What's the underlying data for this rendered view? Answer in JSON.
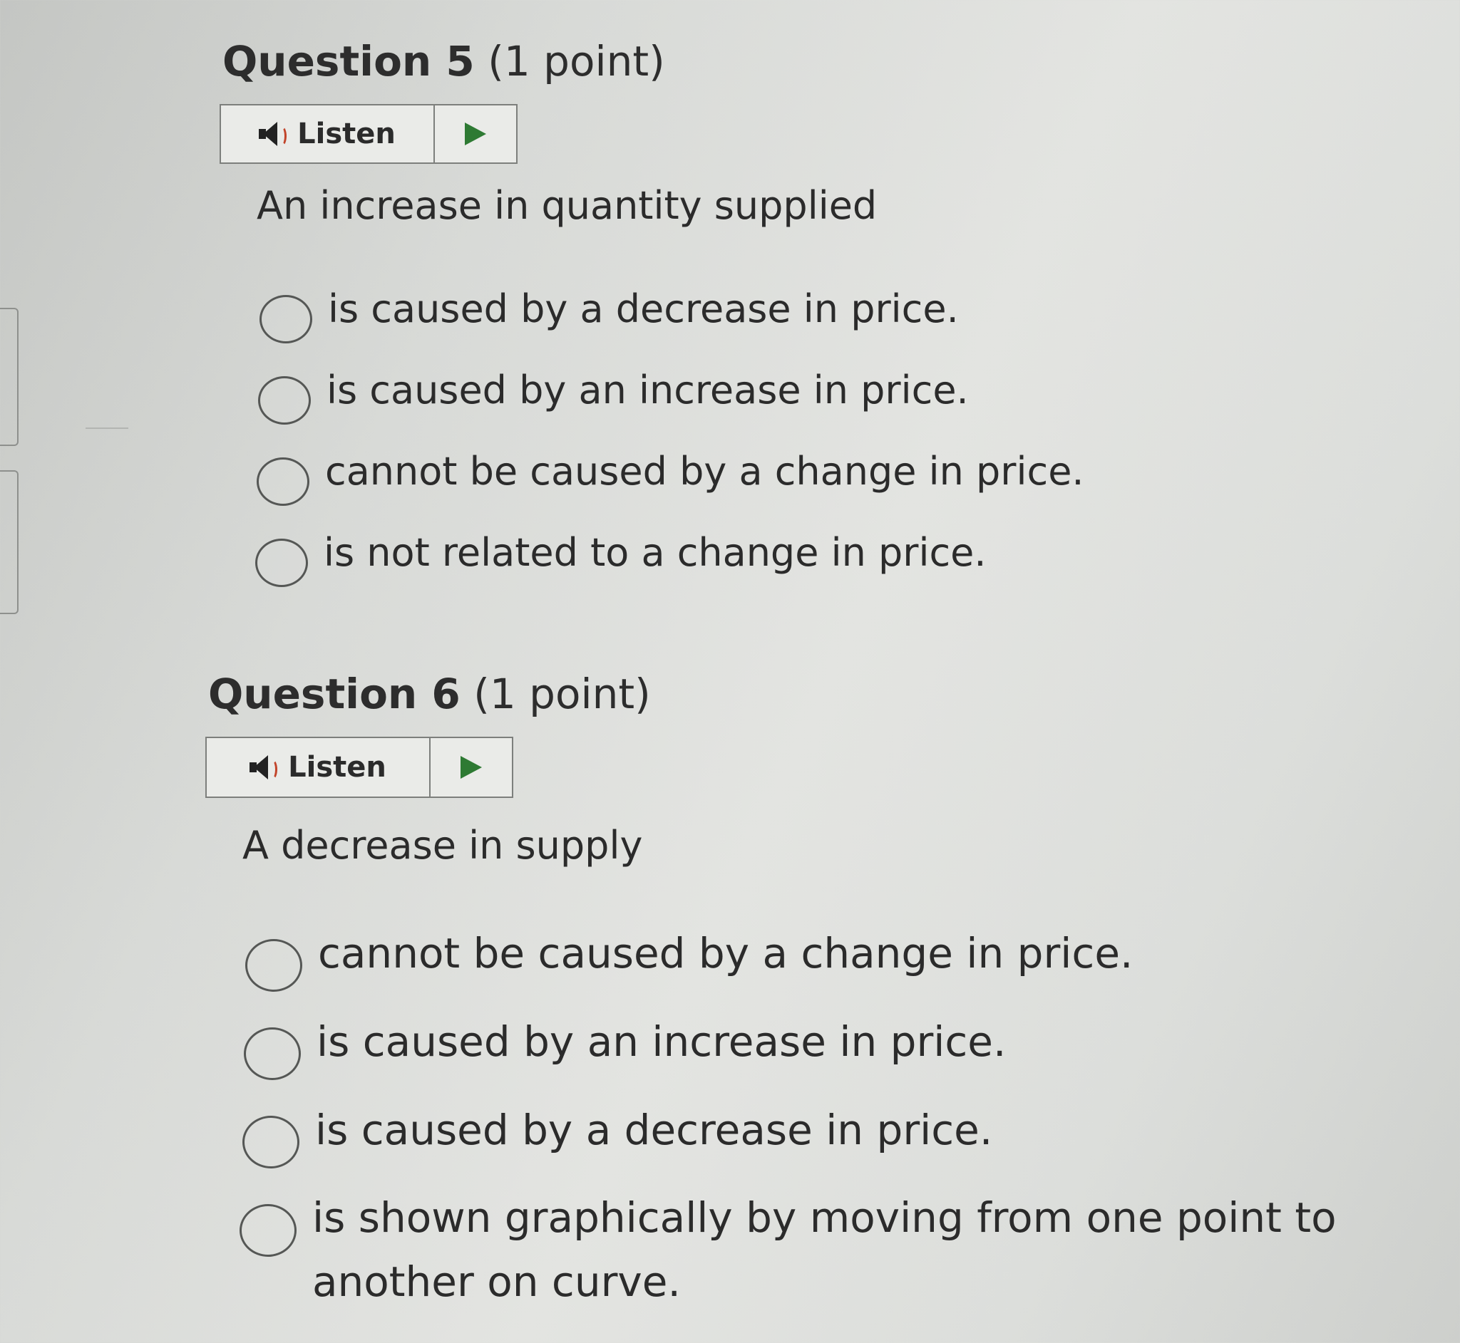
{
  "questions": [
    {
      "number": "Question 5",
      "points": "(1 point)",
      "listen_label": "Listen",
      "prompt": "An increase in quantity supplied",
      "options": [
        "is caused by a decrease in price.",
        "is caused by an increase in price.",
        "cannot be caused by a change in price.",
        "is not related to a change in price."
      ]
    },
    {
      "number": "Question 6",
      "points": "(1 point)",
      "listen_label": "Listen",
      "prompt": "A decrease in supply",
      "options": [
        "cannot be caused by a change in price.",
        "is caused by an increase in price.",
        "is caused by a decrease in price.",
        "is shown graphically by moving from one point to another on curve."
      ]
    }
  ],
  "icons": {
    "speaker": "speaker-icon",
    "play": "play-icon",
    "radio": "radio-empty-icon"
  },
  "colors": {
    "play_icon": "#2e7a33",
    "speaker_wave": "#c2442a"
  }
}
